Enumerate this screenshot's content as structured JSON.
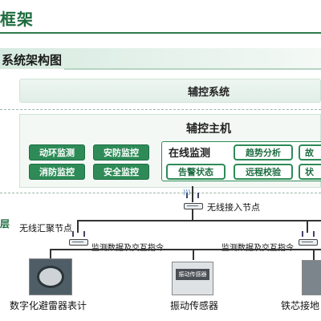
{
  "header": {
    "title": "框架"
  },
  "section": {
    "title": "系统架构图"
  },
  "platform": {
    "label": "辅控系统"
  },
  "host": {
    "label": "辅控主机",
    "modules": [
      "动环监测",
      "安防监控",
      "消防监控",
      "安全监控"
    ],
    "online_title": "在线监测",
    "online_items": [
      "趋势分析",
      "告警状态",
      "远程校验"
    ],
    "cut_items": [
      "故",
      "状"
    ]
  },
  "network": {
    "layer_label": "层",
    "wireless_access_node": "无线接入节点",
    "wireless_aggregation_node": "无线汇聚节点",
    "link_label_left": "监测数据及交互指令",
    "link_label_right": "监测数据及交互指令"
  },
  "devices": [
    {
      "label": "数字化避雷器表计",
      "photo_color": "#5a6a72"
    },
    {
      "label": "振动传感器",
      "photo_color": "#d9dcdf",
      "photo_text": "振动传感器"
    },
    {
      "label": "铁芯接地"
    }
  ],
  "colors": {
    "accent": "#2e8b57",
    "title": "#1d6b3f"
  }
}
